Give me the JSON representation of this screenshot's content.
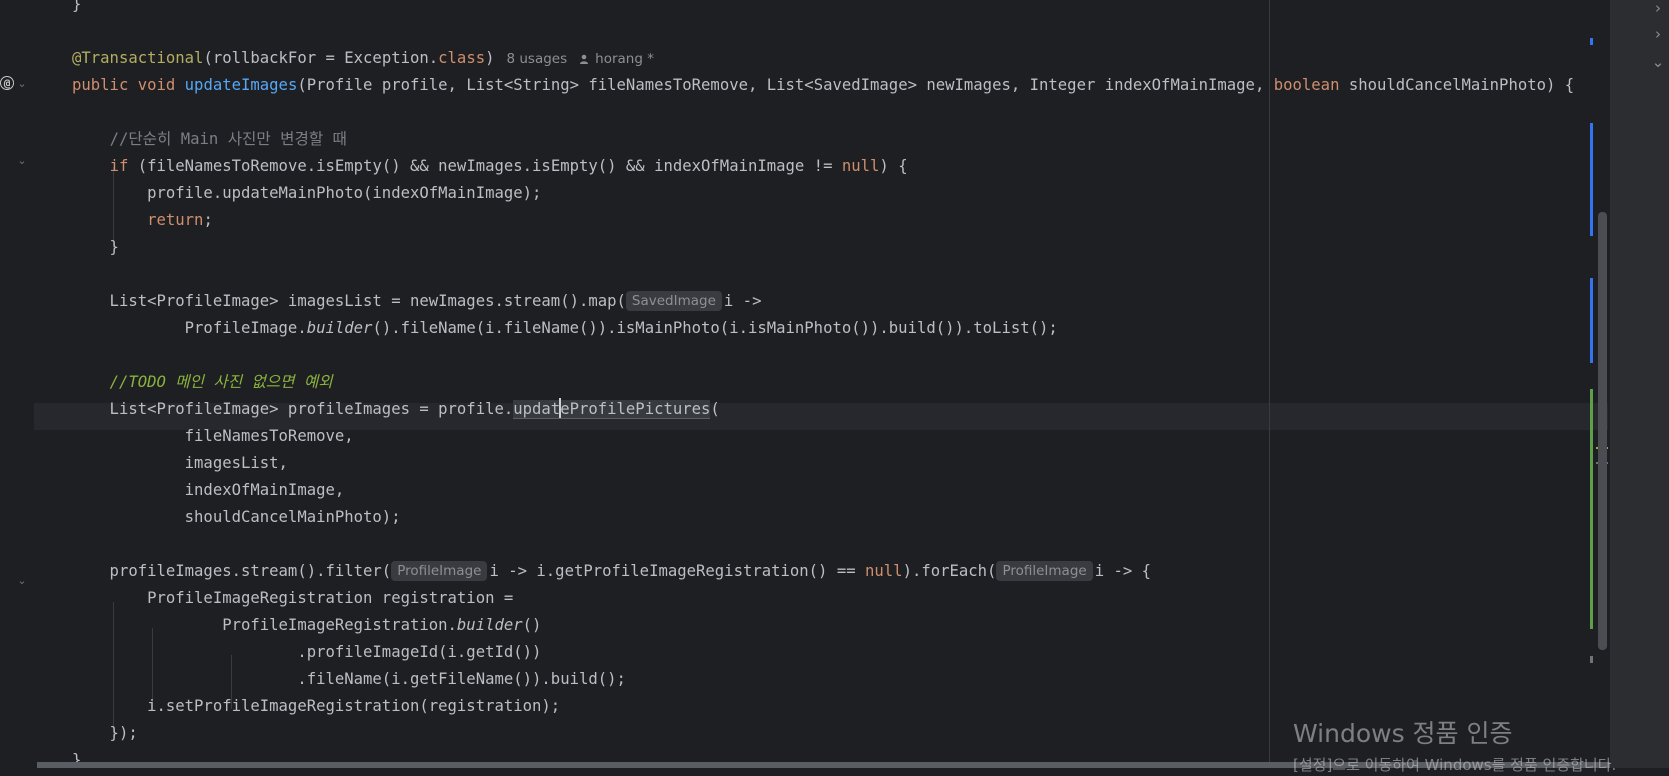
{
  "gutter": {
    "marker": "@"
  },
  "inlay_hints": {
    "usages": "8 usages",
    "author": "horang *",
    "saved_image": "SavedImage",
    "profile_image_1": "ProfileImage",
    "profile_image_2": "ProfileImage"
  },
  "code": {
    "line0": "}",
    "comment_main": "//단순히 Main 사진만 변경할 때",
    "todo": "//TODO 메인 사진 없으면 예외"
  },
  "watermark": {
    "title": "Windows 정품 인증",
    "subtitle": "[설정]으로 이동하여 Windows를 정품 인증합니다."
  },
  "colors": {
    "background": "#1e1f22",
    "keyword": "#cf8e6d",
    "annotation": "#b3ae60",
    "method": "#56a8f5",
    "comment": "#7a7e85",
    "todo": "#8bb33d"
  },
  "icons": {
    "gutter_marker": "at-override-icon",
    "fold": "chevron-down-icon",
    "author": "person-icon",
    "strip": "chevron-right-icon"
  }
}
